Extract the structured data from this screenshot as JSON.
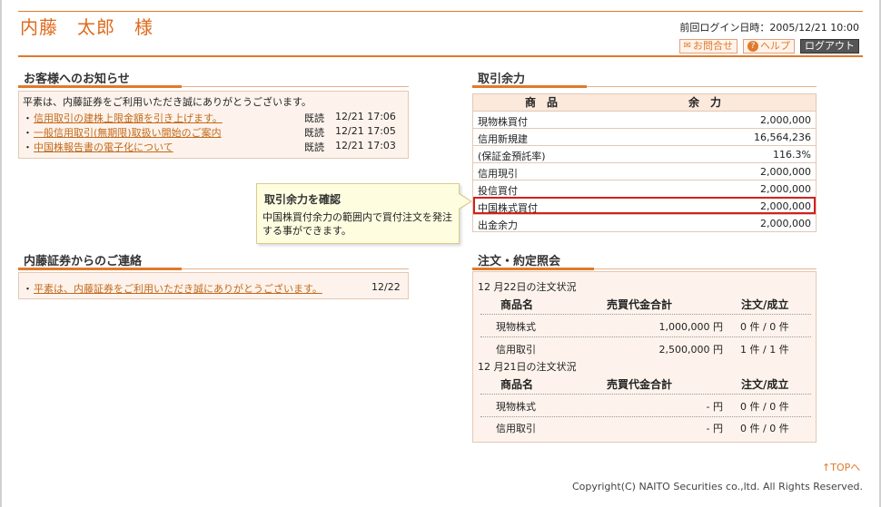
{
  "header": {
    "user_name": "内藤　太郎　様",
    "last_login_label": "前回ログイン日時：",
    "last_login_value": "2005/12/21 10:00",
    "buttons": {
      "inquiry": "お問合せ",
      "help": "ヘルプ",
      "logout": "ログアウト"
    }
  },
  "notices": {
    "title": "お客様へのお知らせ",
    "intro": "平素は、内藤証券をご利用いただき誠にありがとうございます。",
    "items": [
      {
        "text": "信用取引の建株上限金額を引き上げます。",
        "status": "既読",
        "time": "12/21 17:06"
      },
      {
        "text": "一般信用取引(無期限)取扱い開始のご案内",
        "status": "既読",
        "time": "12/21 17:05"
      },
      {
        "text": "中国株報告書の電子化について",
        "status": "既読",
        "time": "12/21 17:03"
      }
    ]
  },
  "contact": {
    "title": "内藤証券からのご連絡",
    "items": [
      {
        "text": "平素は、内藤証券をご利用いただき誠にありがとうございます。",
        "date": "12/22"
      }
    ]
  },
  "balance": {
    "title": "取引余力",
    "col_product": "商　品",
    "col_amount": "余　力",
    "rows": [
      {
        "name": "現物株買付",
        "value": "2,000,000"
      },
      {
        "name": "信用新規建",
        "value": "16,564,236"
      },
      {
        "name": "(保証金預託率)",
        "value": "116.3%"
      },
      {
        "name": "信用現引",
        "value": "2,000,000"
      },
      {
        "name": "投信買付",
        "value": "2,000,000"
      },
      {
        "name": "中国株式買付",
        "value": "2,000,000"
      },
      {
        "name": "出金余力",
        "value": "2,000,000"
      }
    ]
  },
  "tooltip": {
    "title": "取引余力を確認",
    "body": "中国株買付余力の範囲内で買付注文を発注する事ができます。"
  },
  "orders": {
    "title": "注文・約定照会",
    "col_product": "商品名",
    "col_total": "売買代金合計",
    "col_status": "注文/成立",
    "days": [
      {
        "date": "12 月22日の注文状況",
        "rows": [
          {
            "name": "現物株式",
            "total": "1,000,000 円",
            "status": "0 件 / 0 件"
          },
          {
            "name": "信用取引",
            "total": "2,500,000 円",
            "status": "1 件 / 1 件"
          }
        ]
      },
      {
        "date": "12 月21日の注文状況",
        "rows": [
          {
            "name": "現物株式",
            "total": "- 円",
            "status": "0 件 / 0 件"
          },
          {
            "name": "信用取引",
            "total": "- 円",
            "status": "0 件 / 0 件"
          }
        ]
      }
    ]
  },
  "footer": {
    "top_link": "TOPへ",
    "copyright": "Copyright(C) NAITO Securities co.,ltd. All Rights Reserved."
  },
  "colors": {
    "accent": "#e07a2c",
    "panel_bg": "#fdf3ec",
    "highlight": "#d42020"
  }
}
